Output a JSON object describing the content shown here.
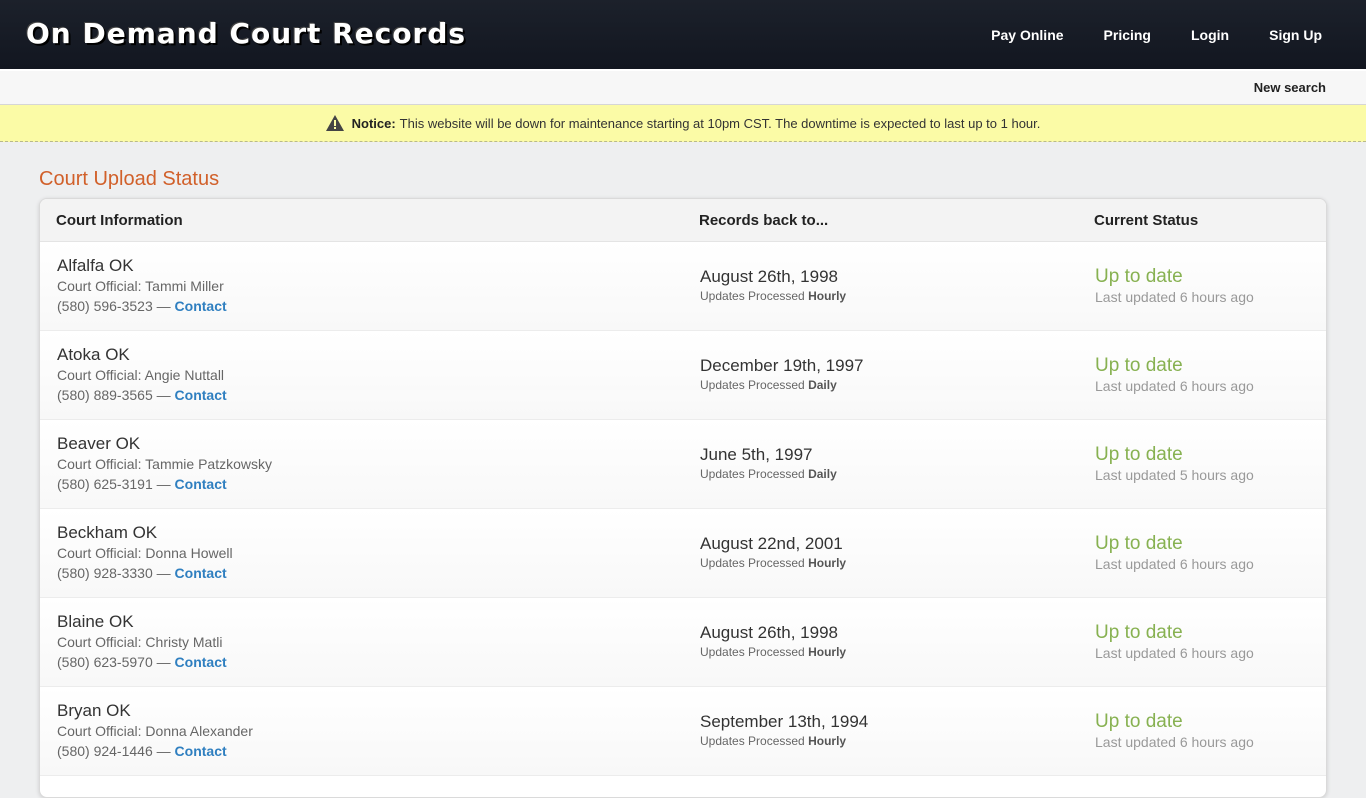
{
  "header": {
    "logo": "On Demand Court Records",
    "nav": [
      "Pay Online",
      "Pricing",
      "Login",
      "Sign Up"
    ]
  },
  "subbar": {
    "new_search": "New search"
  },
  "notice": {
    "label": "Notice:",
    "text": "This website will be down for maintenance starting at 10pm CST. The downtime is expected to last up to 1 hour."
  },
  "page": {
    "title": "Court Upload Status"
  },
  "table": {
    "columns": [
      "Court Information",
      "Records back to...",
      "Current Status"
    ],
    "processed_label": "Updates Processed",
    "contact_label": "Contact",
    "rows": [
      {
        "court": "Alfalfa OK",
        "official": "Court Official: Tammi Miller",
        "phone": "(580) 596-3523 — ",
        "date": "August 26th, 1998",
        "frequency": "Hourly",
        "status": "Up to date",
        "updated": "Last updated 6 hours ago"
      },
      {
        "court": "Atoka OK",
        "official": "Court Official: Angie Nuttall",
        "phone": "(580) 889-3565 — ",
        "date": "December 19th, 1997",
        "frequency": "Daily",
        "status": "Up to date",
        "updated": "Last updated 6 hours ago"
      },
      {
        "court": "Beaver OK",
        "official": "Court Official: Tammie Patzkowsky",
        "phone": "(580) 625-3191 — ",
        "date": "June 5th, 1997",
        "frequency": "Daily",
        "status": "Up to date",
        "updated": "Last updated 5 hours ago"
      },
      {
        "court": "Beckham OK",
        "official": "Court Official: Donna Howell",
        "phone": "(580) 928-3330 — ",
        "date": "August 22nd, 2001",
        "frequency": "Hourly",
        "status": "Up to date",
        "updated": "Last updated 6 hours ago"
      },
      {
        "court": "Blaine OK",
        "official": "Court Official: Christy Matli",
        "phone": "(580) 623-5970 — ",
        "date": "August 26th, 1998",
        "frequency": "Hourly",
        "status": "Up to date",
        "updated": "Last updated 6 hours ago"
      },
      {
        "court": "Bryan OK",
        "official": "Court Official: Donna Alexander",
        "phone": "(580) 924-1446 — ",
        "date": "September 13th, 1994",
        "frequency": "Hourly",
        "status": "Up to date",
        "updated": "Last updated 6 hours ago"
      }
    ]
  },
  "colors": {
    "accent": "#d1602a",
    "status_ok": "#87b151",
    "link": "#2f7fc0",
    "notice_bg": "#fbfba6"
  },
  "icons": {
    "notice": "warning-triangle-icon"
  }
}
